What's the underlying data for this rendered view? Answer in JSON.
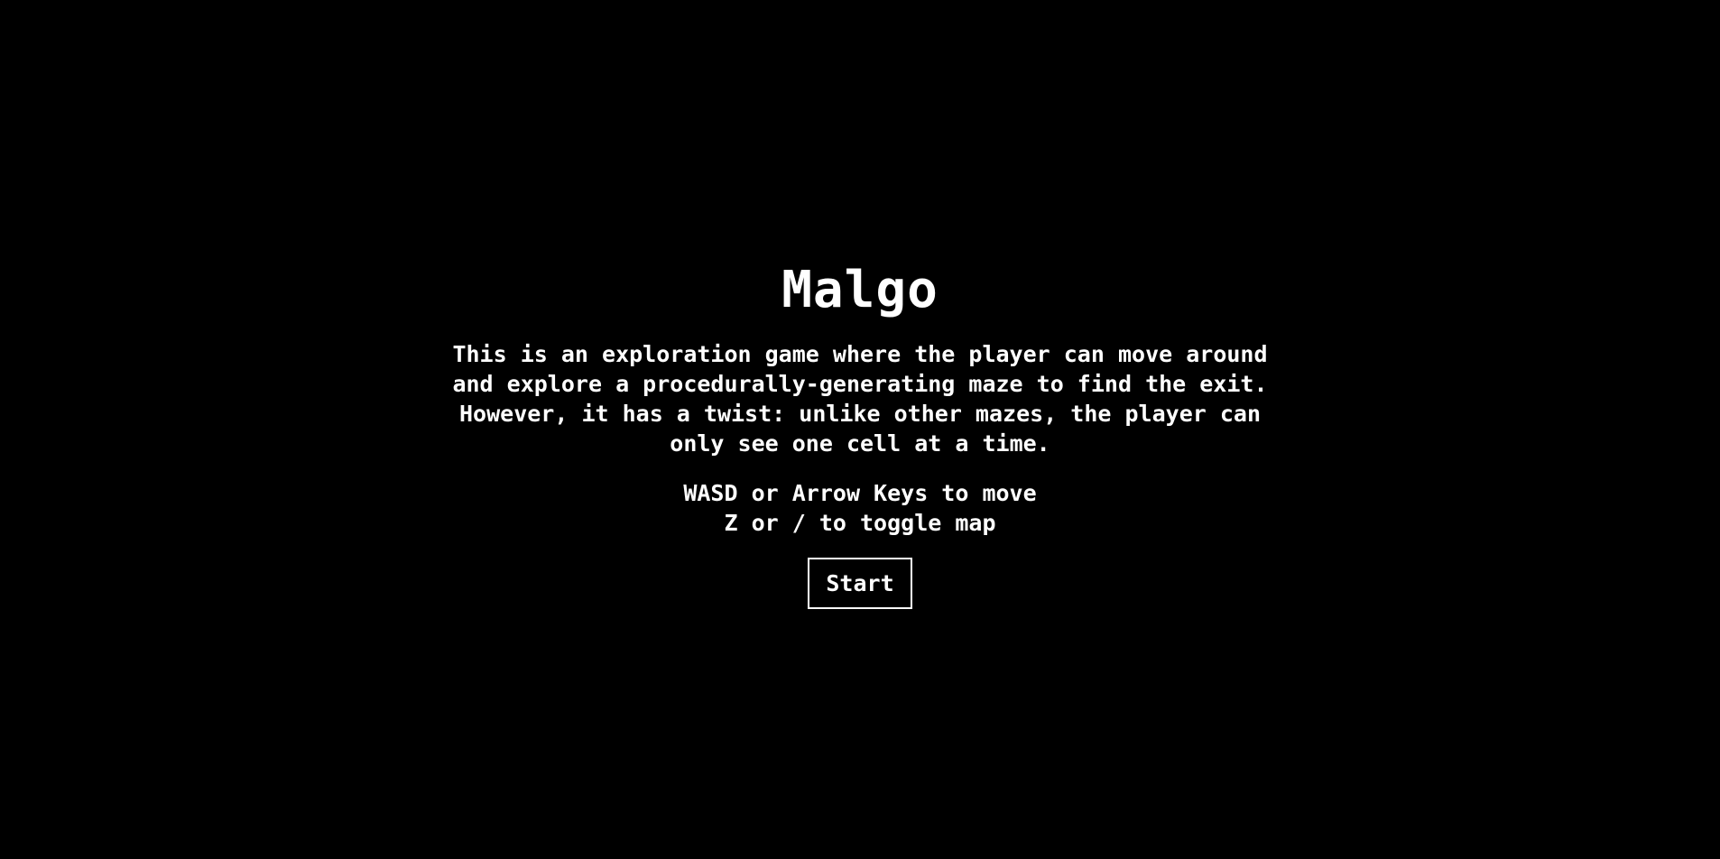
{
  "game": {
    "title": "Malgo",
    "description": "This is an exploration game where the player can move around and explore a procedurally-generating maze to find the exit. However, it has a twist: unlike other mazes, the player can only see one cell at a time.",
    "controls": [
      "WASD or Arrow Keys to move",
      "Z or / to toggle map"
    ],
    "start_label": "Start"
  },
  "colors": {
    "background": "#000000",
    "text": "#ffffff",
    "button_border": "#ffffff"
  }
}
